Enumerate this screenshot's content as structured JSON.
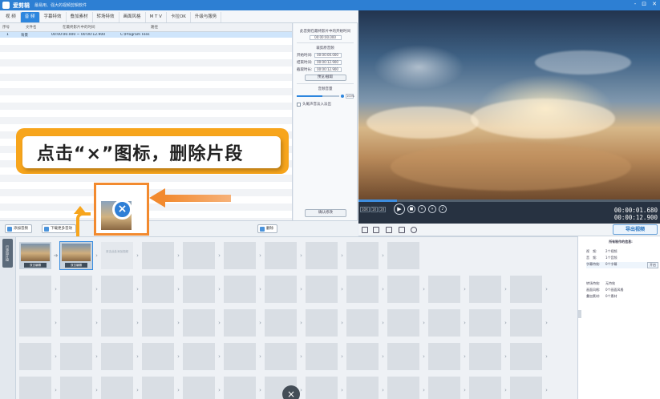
{
  "app": {
    "name": "爱剪辑",
    "slogan": "最易用、强大的视频剪辑软件"
  },
  "window_controls": [
    "-",
    "⊡",
    "✕"
  ],
  "menu_tabs": [
    "视 频",
    "音 频",
    "字幕特效",
    "叠加素材",
    "转场特效",
    "画面风格",
    "M T V",
    "卡拉OK",
    "升级与服务"
  ],
  "active_tab_index": 1,
  "list": {
    "headers": [
      "序号",
      "文件名",
      "在最终影片中的时间",
      "路径"
    ],
    "rows": [
      {
        "index": "1",
        "name": "背景",
        "time": "00:00:00.000 ~ 00:00:12.900",
        "path": "C:\\Program Files"
      }
    ]
  },
  "side": {
    "pos_label": "此音频在最终影片中的开始时间",
    "pos_value": "00:00:00.000",
    "clip_label": "裁剪原音频",
    "start_label": "开始时间:",
    "start_value": "00:00:00.000",
    "end_label": "结束时间:",
    "end_value": "00:00:12.900",
    "dur_label": "截取时长:",
    "dur_value": "00:00:12.900",
    "preview_btn": "预览/截取",
    "vol_label": "音频音量",
    "vol_value": "100%",
    "fade_label": "头尾声音淡入淡出",
    "confirm_btn": "确认修改"
  },
  "toolbar": {
    "add_audio": "添加音频",
    "download_more": "下载更多音效",
    "delete": "删除"
  },
  "player": {
    "speed": [
      "10X",
      "1X",
      "2X"
    ],
    "time_current": "00:00:01.680",
    "time_total": "00:00:12.900"
  },
  "export_btn": "导出视频",
  "timeline": {
    "side_label": "已添加片段",
    "clips": [
      {
        "caption": "双击编辑"
      },
      {
        "caption": "双击编辑"
      }
    ],
    "ghost_text": "双击此处添加视频"
  },
  "info": {
    "title": "所有制作的信息:",
    "rows": [
      {
        "k": "视　频:",
        "v": "2个视频"
      },
      {
        "k": "音　频:",
        "v": "1个音频"
      },
      {
        "k": "字幕特效:",
        "v": "0个字幕"
      },
      {
        "k": "转场特效:",
        "v": "无特效"
      },
      {
        "k": "画面风格:",
        "v": "0个画面风格"
      },
      {
        "k": "叠加素材:",
        "v": "0个素材"
      }
    ],
    "open_btn": "开启"
  },
  "callout": {
    "text": "点击“×”图标，删除片段"
  },
  "colors": {
    "brand": "#2d7fd3",
    "callout": "#f7a51c",
    "highlight": "#f28a2f"
  }
}
